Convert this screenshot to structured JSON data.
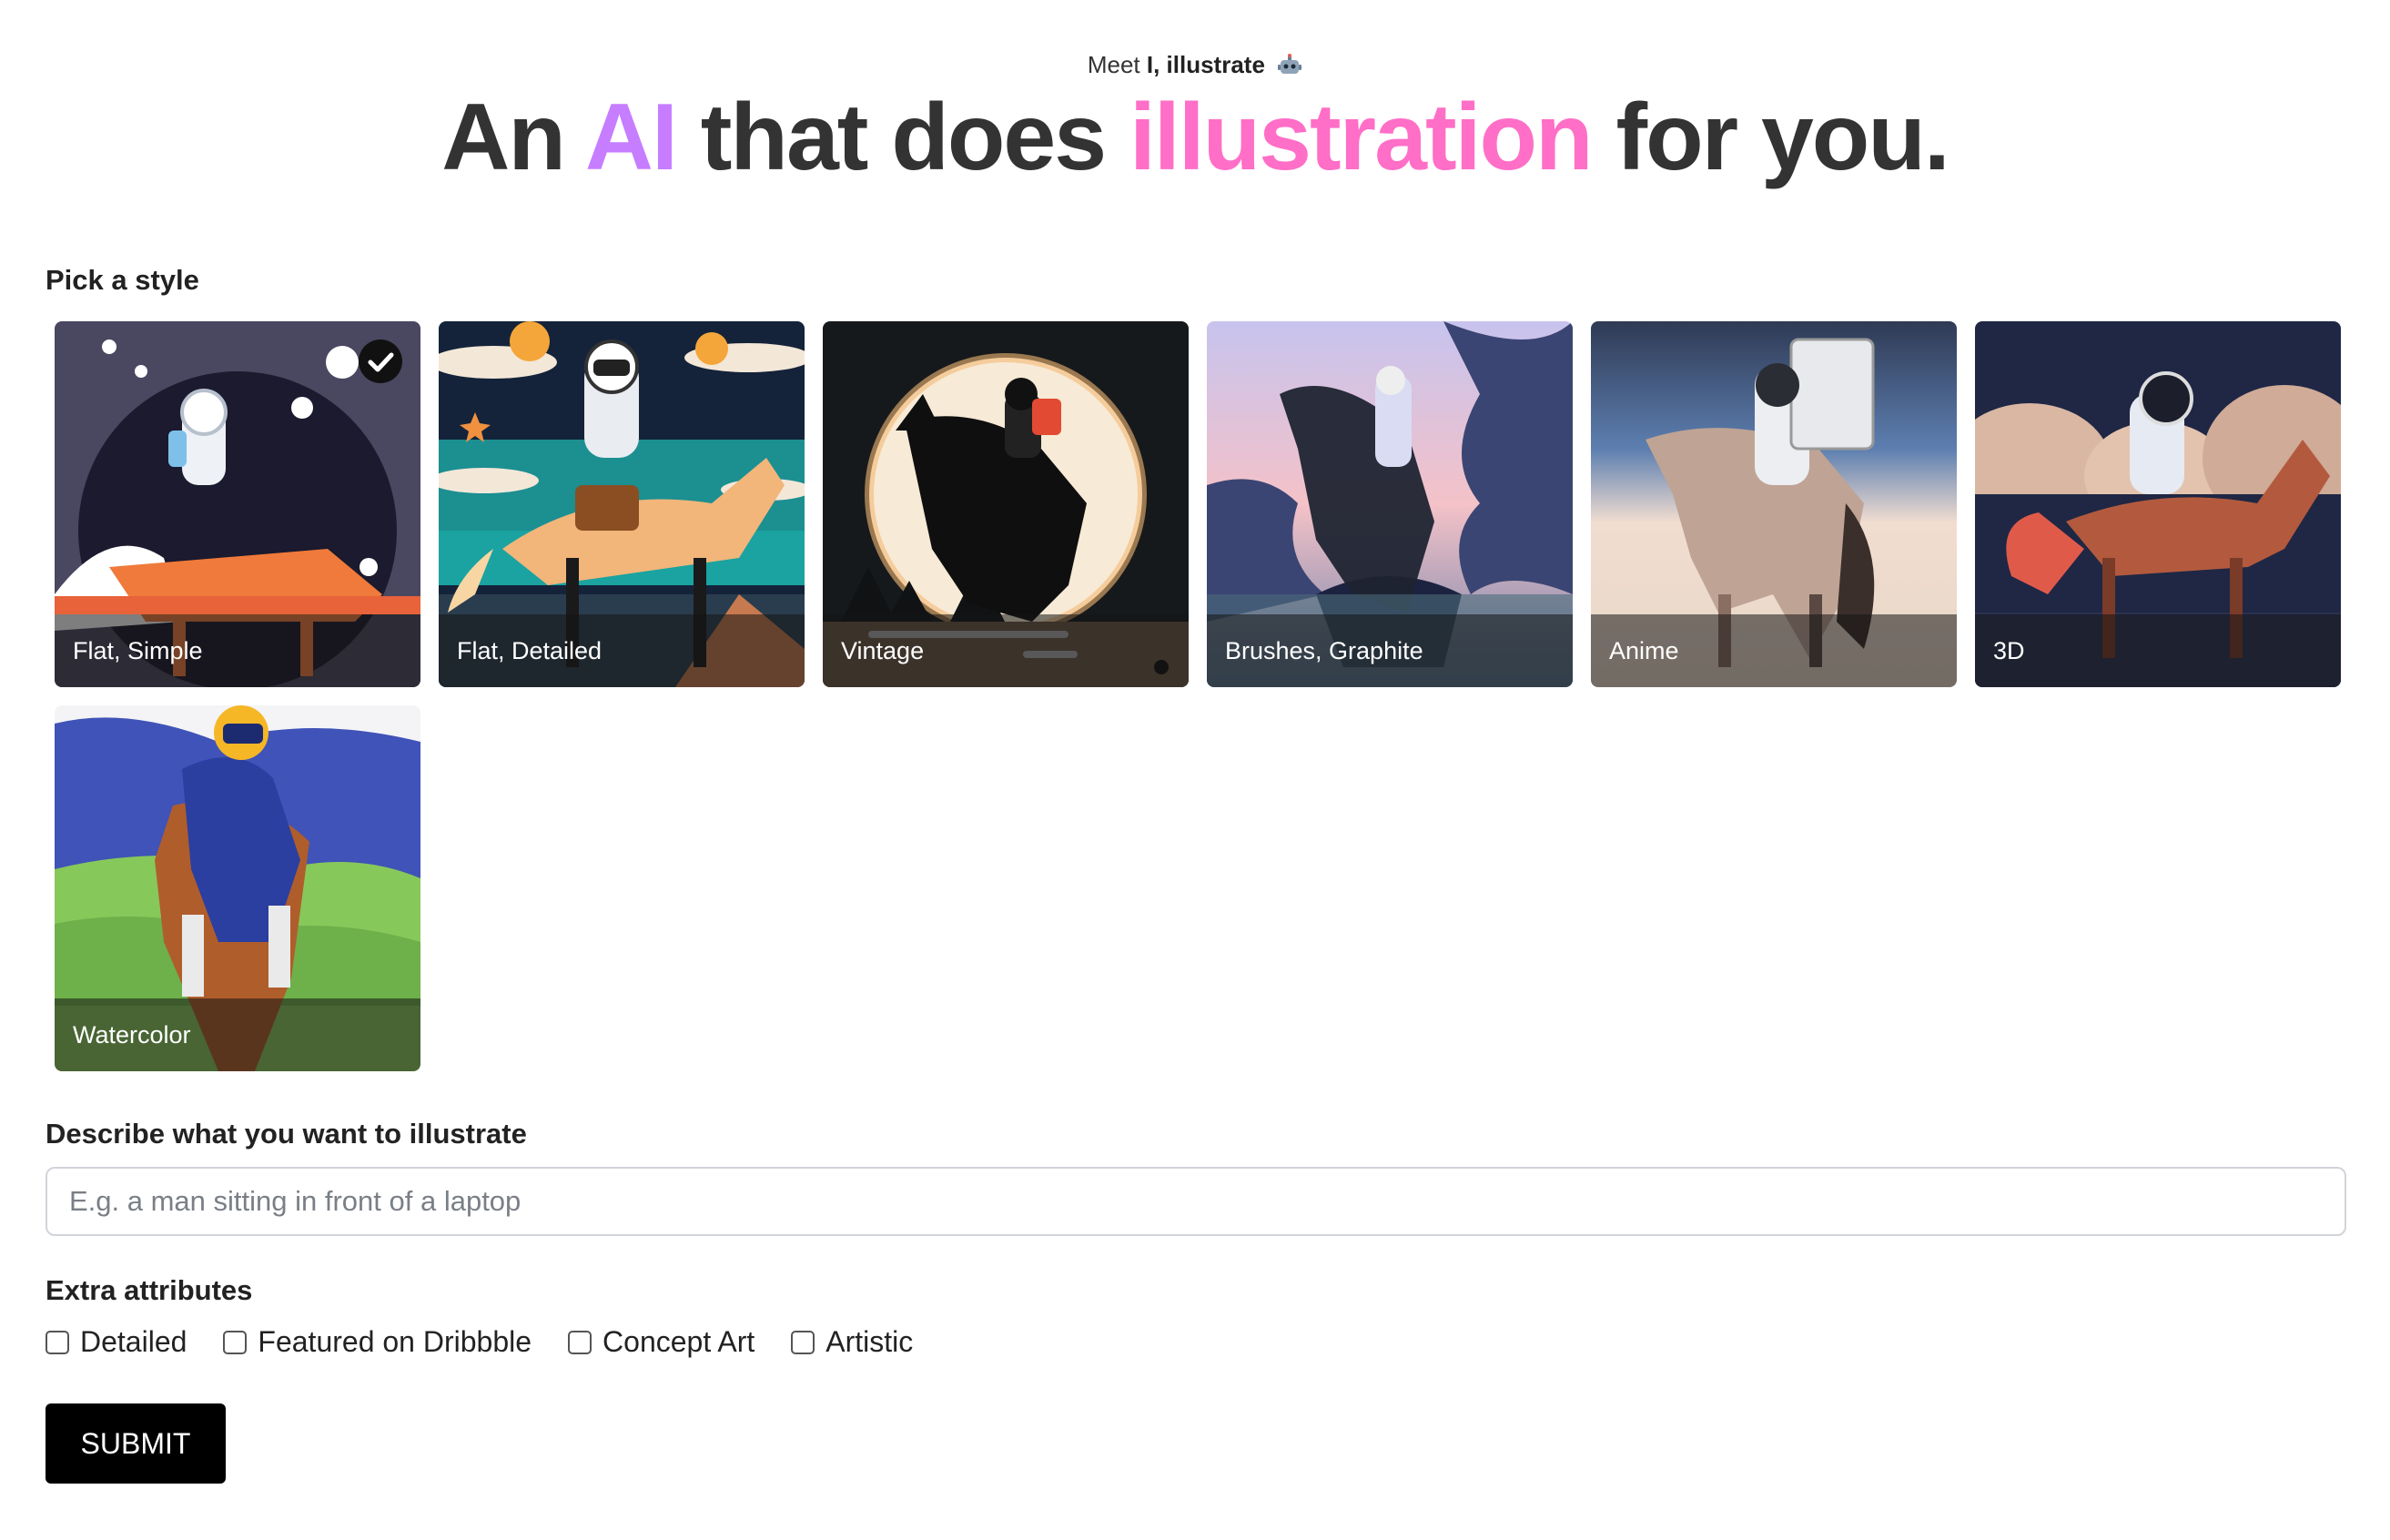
{
  "header": {
    "eyebrow_prefix": "Meet",
    "eyebrow_brand": "I, illustrate",
    "eyebrow_icon": "robot-icon",
    "headline_part1": "An ",
    "headline_ai": "AI",
    "headline_part2": " that does ",
    "headline_illustration": "illustration",
    "headline_part3": " for you."
  },
  "colors": {
    "ai_accent": "#c77dff",
    "illustration_accent": "#ff6ec7",
    "submit_bg": "#000000"
  },
  "styles_section": {
    "label": "Pick a style",
    "selected_index": 0,
    "selected_icon": "checkmark-icon",
    "items": [
      {
        "label": "Flat, Simple"
      },
      {
        "label": "Flat, Detailed"
      },
      {
        "label": "Vintage"
      },
      {
        "label": "Brushes, Graphite"
      },
      {
        "label": "Anime"
      },
      {
        "label": "3D"
      },
      {
        "label": "Watercolor"
      }
    ]
  },
  "describe": {
    "label": "Describe what you want to illustrate",
    "placeholder": "E.g. a man sitting in front of a laptop",
    "value": ""
  },
  "extras": {
    "label": "Extra attributes",
    "options": [
      {
        "label": "Detailed",
        "checked": false
      },
      {
        "label": "Featured on Dribbble",
        "checked": false
      },
      {
        "label": "Concept Art",
        "checked": false
      },
      {
        "label": "Artistic",
        "checked": false
      }
    ]
  },
  "submit": {
    "label": "SUBMIT"
  }
}
